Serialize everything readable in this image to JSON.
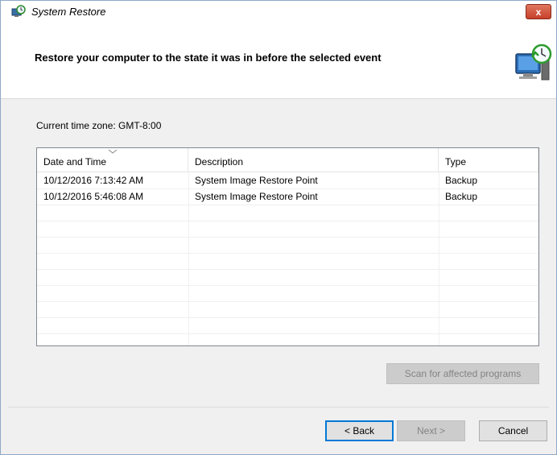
{
  "window": {
    "title": "System Restore",
    "close_label": "x"
  },
  "header": {
    "title": "Restore your computer to the state it was in before the selected event"
  },
  "timezone": "Current time zone: GMT-8:00",
  "list": {
    "columns": [
      "Date and Time",
      "Description",
      "Type"
    ],
    "sorted_column": "Date and Time",
    "rows": [
      {
        "date": "10/12/2016 7:13:42 AM",
        "description": "System Image Restore Point",
        "type": "Backup"
      },
      {
        "date": "10/12/2016 5:46:08 AM",
        "description": "System Image Restore Point",
        "type": "Backup"
      }
    ]
  },
  "buttons": {
    "scan": "Scan for affected programs",
    "back": "< Back",
    "next": "Next >",
    "cancel": "Cancel"
  },
  "icons": {
    "title": "system-restore-icon",
    "header": "computer-clock-icon",
    "sort": "chevron-down-icon"
  },
  "colors": {
    "accent": "#0078d7",
    "close": "#c7402a"
  }
}
